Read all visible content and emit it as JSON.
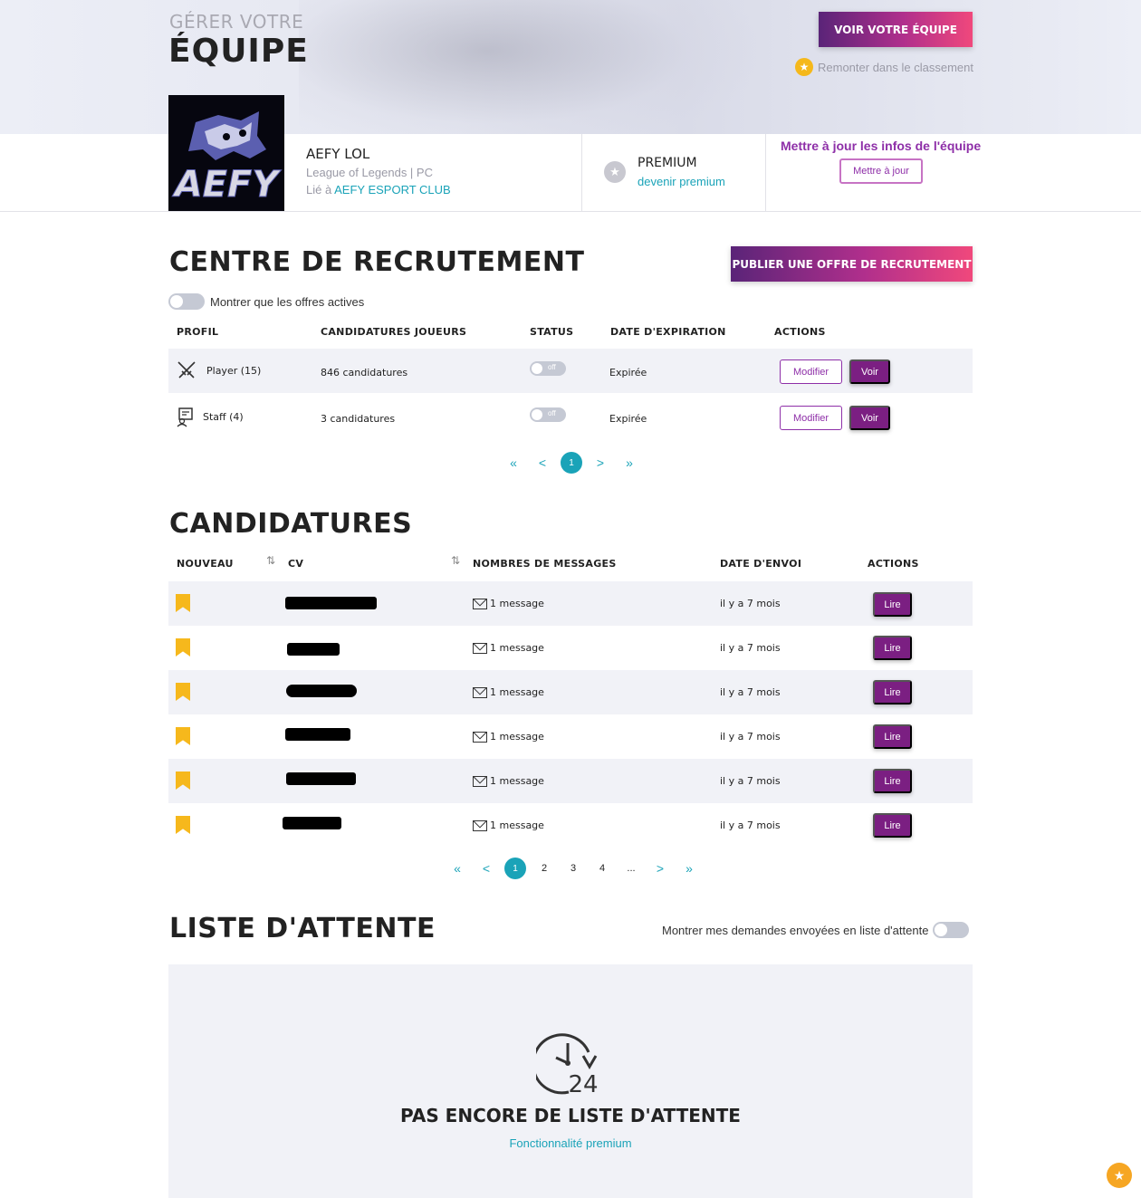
{
  "header": {
    "kicker": "GÉRER VOTRE",
    "title": "ÉQUIPE",
    "view_team_button": "VOIR VOTRE ÉQUIPE",
    "rank_link": "Remonter dans le classement"
  },
  "team": {
    "logo_text": "AEFY",
    "name": "AEFY LOL",
    "game_platform": "League of Legends | PC",
    "linked_prefix": "Lié à",
    "linked_club": "AEFY ESPORT CLUB",
    "premium_title": "PREMIUM",
    "premium_link": "devenir premium",
    "update_title": "Mettre à jour les infos de l'équipe",
    "update_button": "Mettre à jour"
  },
  "recruitment": {
    "title": "CENTRE DE RECRUTEMENT",
    "publish_button": "PUBLIER UNE OFFRE DE RECRUTEMENT",
    "toggle_label": "Montrer que les offres actives",
    "columns": [
      "PROFIL",
      "CANDIDATURES JOUEURS",
      "STATUS",
      "DATE D'EXPIRATION",
      "ACTIONS"
    ],
    "rows": [
      {
        "profile": "Player (15)",
        "applications": "846 candidatures",
        "status": "off",
        "expiration": "Expirée",
        "edit": "Modifier",
        "view": "Voir"
      },
      {
        "profile": "Staff (4)",
        "applications": "3 candidatures",
        "status": "off",
        "expiration": "Expirée",
        "edit": "Modifier",
        "view": "Voir"
      }
    ],
    "pagination": {
      "first": "«",
      "prev": "<",
      "pages": [
        "1"
      ],
      "next": ">",
      "last": "»"
    }
  },
  "applications": {
    "title": "CANDIDATURES",
    "columns": [
      "NOUVEAU",
      "CV",
      "NOMBRES DE MESSAGES",
      "DATE D'ENVOI",
      "ACTIONS"
    ],
    "rows": [
      {
        "messages": "1 message",
        "sent": "il y a 7 mois",
        "action": "Lire"
      },
      {
        "messages": "1 message",
        "sent": "il y a 7 mois",
        "action": "Lire"
      },
      {
        "messages": "1 message",
        "sent": "il y a 7 mois",
        "action": "Lire"
      },
      {
        "messages": "1 message",
        "sent": "il y a 7 mois",
        "action": "Lire"
      },
      {
        "messages": "1 message",
        "sent": "il y a 7 mois",
        "action": "Lire"
      },
      {
        "messages": "1 message",
        "sent": "il y a 7 mois",
        "action": "Lire"
      }
    ],
    "pagination": {
      "first": "«",
      "prev": "<",
      "pages": [
        "1",
        "2",
        "3",
        "4",
        "..."
      ],
      "next": ">",
      "last": "»"
    }
  },
  "waitlist": {
    "title": "LISTE D'ATTENTE",
    "toggle_label": "Montrer mes demandes envoyées en liste d'attente",
    "empty_icon_text": "24",
    "empty_title": "PAS ENCORE DE LISTE D'ATTENTE",
    "empty_link": "Fonctionnalité premium"
  },
  "colors": {
    "accent_teal": "#1aa3b8",
    "purple": "#7b1f82",
    "gradient_start": "#5a2478",
    "gradient_end": "#f0487c",
    "bookmark": "#f6b81c"
  }
}
